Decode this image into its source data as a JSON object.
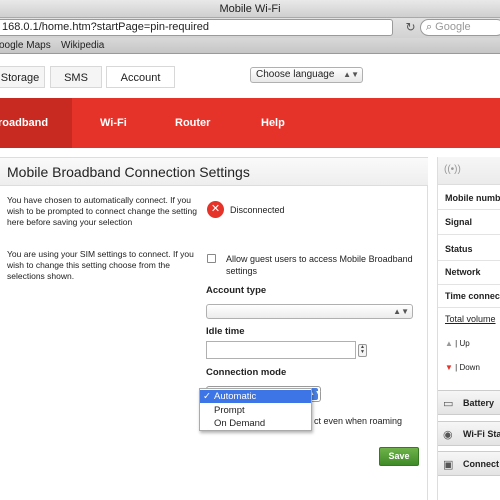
{
  "window": {
    "title": "Mobile Wi-Fi"
  },
  "browser": {
    "url": "168.0.1/home.htm?startPage=pin-required",
    "search_placeholder": "Google",
    "bookmarks": [
      "oogle Maps",
      "Wikipedia"
    ]
  },
  "top_tabs": [
    "Storage",
    "SMS",
    "Account"
  ],
  "language_select": {
    "value": "Choose language"
  },
  "nav": [
    "roadband",
    "Wi-Fi",
    "Router",
    "Help"
  ],
  "main": {
    "title": "Mobile Broadband Connection Settings",
    "para1": "You have chosen to automatically connect. If you wish to be prompted to connect change the setting here before saving your selection",
    "para2": "You are using your SIM settings to connect. If you wish to change this setting choose from the selections shown.",
    "status": "Disconnected",
    "guest_label": "Allow guest users to access Mobile Broadband settings",
    "account_type_label": "Account type",
    "idle_time_label": "Idle time",
    "connection_mode_label": "Connection mode",
    "connection_mode_options": [
      "Automatic",
      "Prompt",
      "On Demand"
    ],
    "roaming_text": "ct even when roaming",
    "save_label": "Save"
  },
  "sidebar": {
    "rows": [
      "Mobile numb",
      "Signal",
      "Status",
      "Network",
      "Time connec",
      "Total volume"
    ],
    "up": "Up",
    "down": "Down",
    "panels": [
      "Battery",
      "Wi-Fi Sta",
      "Connect"
    ]
  },
  "colors": {
    "brand_red": "#e5332a",
    "save_green": "#4c9a30",
    "selection_blue": "#3d74e6"
  }
}
